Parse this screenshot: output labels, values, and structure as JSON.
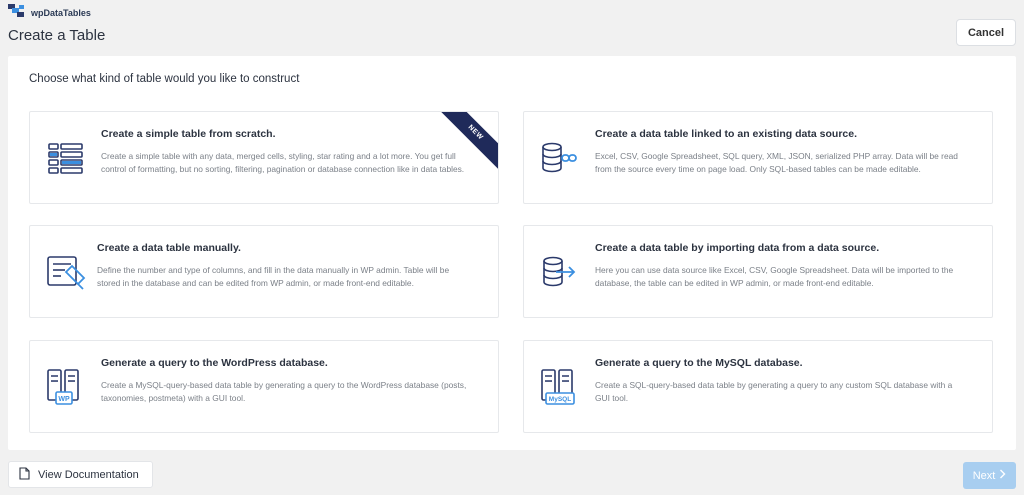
{
  "brand": {
    "name": "wpDataTables",
    "logo_icon": "wpdatatables-logo-icon"
  },
  "header": {
    "title": "Create a Table",
    "cancel_label": "Cancel"
  },
  "panel": {
    "heading": "Choose what kind of table would you like to construct",
    "cards": [
      {
        "title": "Create a simple table from scratch.",
        "description": "Create a simple table with any data, merged cells, styling, star rating and a lot more. You get full control of formatting, but no sorting, filtering, pagination or database connection like in data tables.",
        "icon": "simple-table-icon",
        "badge": "NEW"
      },
      {
        "title": "Create a data table linked to an existing data source.",
        "description": "Excel, CSV, Google Spreadsheet, SQL query, XML, JSON, serialized PHP array. Data will be read from the source every time on page load. Only SQL-based tables can be made editable.",
        "icon": "linked-data-source-icon"
      },
      {
        "title": "Create a data table manually.",
        "description": "Define the number and type of columns, and fill in the data manually in WP admin. Table will be stored in the database and can be edited from WP admin, or made front-end editable.",
        "icon": "manual-table-icon"
      },
      {
        "title": "Create a data table by importing data from a data source.",
        "description": "Here you can use data source like Excel, CSV, Google Spreadsheet. Data will be imported to the database, the table can be edited in WP admin, or made front-end editable.",
        "icon": "import-data-icon"
      },
      {
        "title": "Generate a query to the WordPress database.",
        "description": "Create a MySQL-query-based data table by generating a query to the WordPress database (posts, taxonomies, postmeta) with a GUI tool.",
        "icon": "wordpress-query-icon",
        "icon_label": "WP"
      },
      {
        "title": "Generate a query to the MySQL database.",
        "description": "Create a SQL-query-based data table by generating a query to any custom SQL database with a GUI tool.",
        "icon": "mysql-query-icon",
        "icon_label": "MySQL"
      }
    ]
  },
  "footer": {
    "documentation_label": "View Documentation",
    "documentation_icon": "document-icon",
    "next_label": "Next",
    "next_icon": "chevron-right-icon"
  },
  "colors": {
    "icon_navy": "#2b3a6b",
    "icon_blue": "#3b8fe0",
    "ribbon": "#1f2a5a",
    "next_disabled": "#a8cef0"
  }
}
